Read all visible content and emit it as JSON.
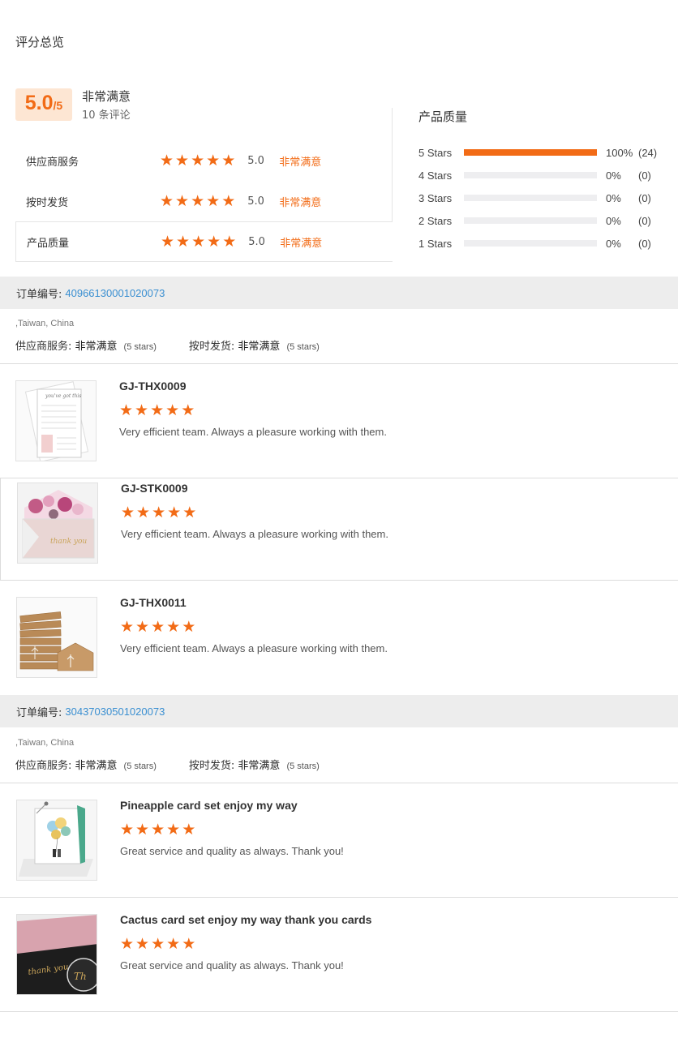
{
  "overview": {
    "title": "评分总览",
    "score": "5.0",
    "score_max": "/5",
    "overall_label": "非常满意",
    "review_count": "10 条评论"
  },
  "dimensions": [
    {
      "name": "供应商服务",
      "stars": 5,
      "score": "5.0",
      "label": "非常满意"
    },
    {
      "name": "按时发货",
      "stars": 5,
      "score": "5.0",
      "label": "非常满意"
    },
    {
      "name": "产品质量",
      "stars": 5,
      "score": "5.0",
      "label": "非常满意"
    }
  ],
  "quality": {
    "title": "产品质量",
    "rows": [
      {
        "label": "5 Stars",
        "fraction": 1.0,
        "pct": "100%",
        "count": "(24)"
      },
      {
        "label": "4 Stars",
        "fraction": 0,
        "pct": "0%",
        "count": "(0)"
      },
      {
        "label": "3 Stars",
        "fraction": 0,
        "pct": "0%",
        "count": "(0)"
      },
      {
        "label": "2 Stars",
        "fraction": 0,
        "pct": "0%",
        "count": "(0)"
      },
      {
        "label": "1 Stars",
        "fraction": 0,
        "pct": "0%",
        "count": "(0)"
      }
    ]
  },
  "colors": {
    "accent": "#f26b16",
    "link": "#3a8fd1",
    "bar_empty": "#eeeef0",
    "badge_bg": "#fde6d3"
  },
  "star_glyph": "★",
  "orders": [
    {
      "label": "订单编号:",
      "number": "40966130001020073",
      "location": ",Taiwan, China",
      "service_label": "供应商服务:",
      "service_value": "非常满意",
      "service_stars": "(5 stars)",
      "shipping_label": "按时发货:",
      "shipping_value": "非常满意",
      "shipping_stars": "(5 stars)",
      "items": [
        {
          "title": "GJ-THX0009",
          "stars": 5,
          "comment": "Very efficient team. Always a pleasure working with them.",
          "thumb": "planner-notepad-thumbnail"
        },
        {
          "title": "GJ-STK0009",
          "stars": 5,
          "comment": "Very efficient team. Always a pleasure working with them.",
          "thumb": "floral-envelope-thumbnail"
        },
        {
          "title": "GJ-THX0011",
          "stars": 5,
          "comment": "Very efficient team. Always a pleasure working with them.",
          "thumb": "kraft-cards-thumbnail"
        }
      ]
    },
    {
      "label": "订单编号:",
      "number": "30437030501020073",
      "location": ",Taiwan, China",
      "service_label": "供应商服务:",
      "service_value": "非常满意",
      "service_stars": "(5 stars)",
      "shipping_label": "按时发货:",
      "shipping_value": "非常满意",
      "shipping_stars": "(5 stars)",
      "items": [
        {
          "title": "Pineapple card set enjoy my way",
          "stars": 5,
          "comment": "Great service and quality as always. Thank you!",
          "thumb": "balloon-card-thumbnail"
        },
        {
          "title": "Cactus card set enjoy my way thank you cards",
          "stars": 5,
          "comment": "Great service and quality as always. Thank you!",
          "thumb": "pink-black-cards-thumbnail"
        }
      ]
    }
  ]
}
